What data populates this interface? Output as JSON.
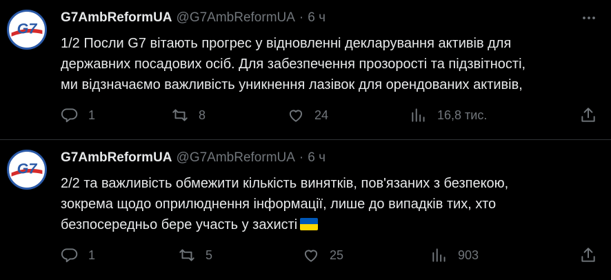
{
  "colors": {
    "background": "#000000",
    "text": "#e7e9ea",
    "muted": "#71767b",
    "divider": "#2f3336",
    "flag_blue": "#0057b7",
    "flag_yellow": "#ffd700"
  },
  "tweets": [
    {
      "author_name": "G7AmbReformUA",
      "handle": "@G7AmbReformUA",
      "separator": "·",
      "time": "6 ч",
      "avatar_text": "G7",
      "lines": [
        "1/2 Посли G7 вітають прогрес у відновленні декларування активів для",
        "державних посадових осіб. Для забезпечення прозорості та підзвітності,",
        "ми відзначаємо важливість уникнення лазівок для орендованих активів,"
      ],
      "replies": "1",
      "reposts": "8",
      "likes": "24",
      "views": "16,8 тис."
    },
    {
      "author_name": "G7AmbReformUA",
      "handle": "@G7AmbReformUA",
      "separator": "·",
      "time": "6 ч",
      "avatar_text": "G7",
      "lines": [
        "2/2 та важливість обмежити кількість винятків, пов'язаних з безпекою,",
        "зокрема щодо оприлюднення інформації, лише до випадків тих, хто",
        "безпосередньо бере участь у захисті"
      ],
      "flag_icon": "ukraine-flag-emoji",
      "replies": "1",
      "reposts": "5",
      "likes": "25",
      "views": "903"
    }
  ],
  "icons": {
    "more": "more-horizontal-icon",
    "reply": "reply-bubble-icon",
    "repost": "repost-arrows-icon",
    "like": "heart-icon",
    "views": "bar-chart-icon",
    "share": "share-upload-icon"
  }
}
